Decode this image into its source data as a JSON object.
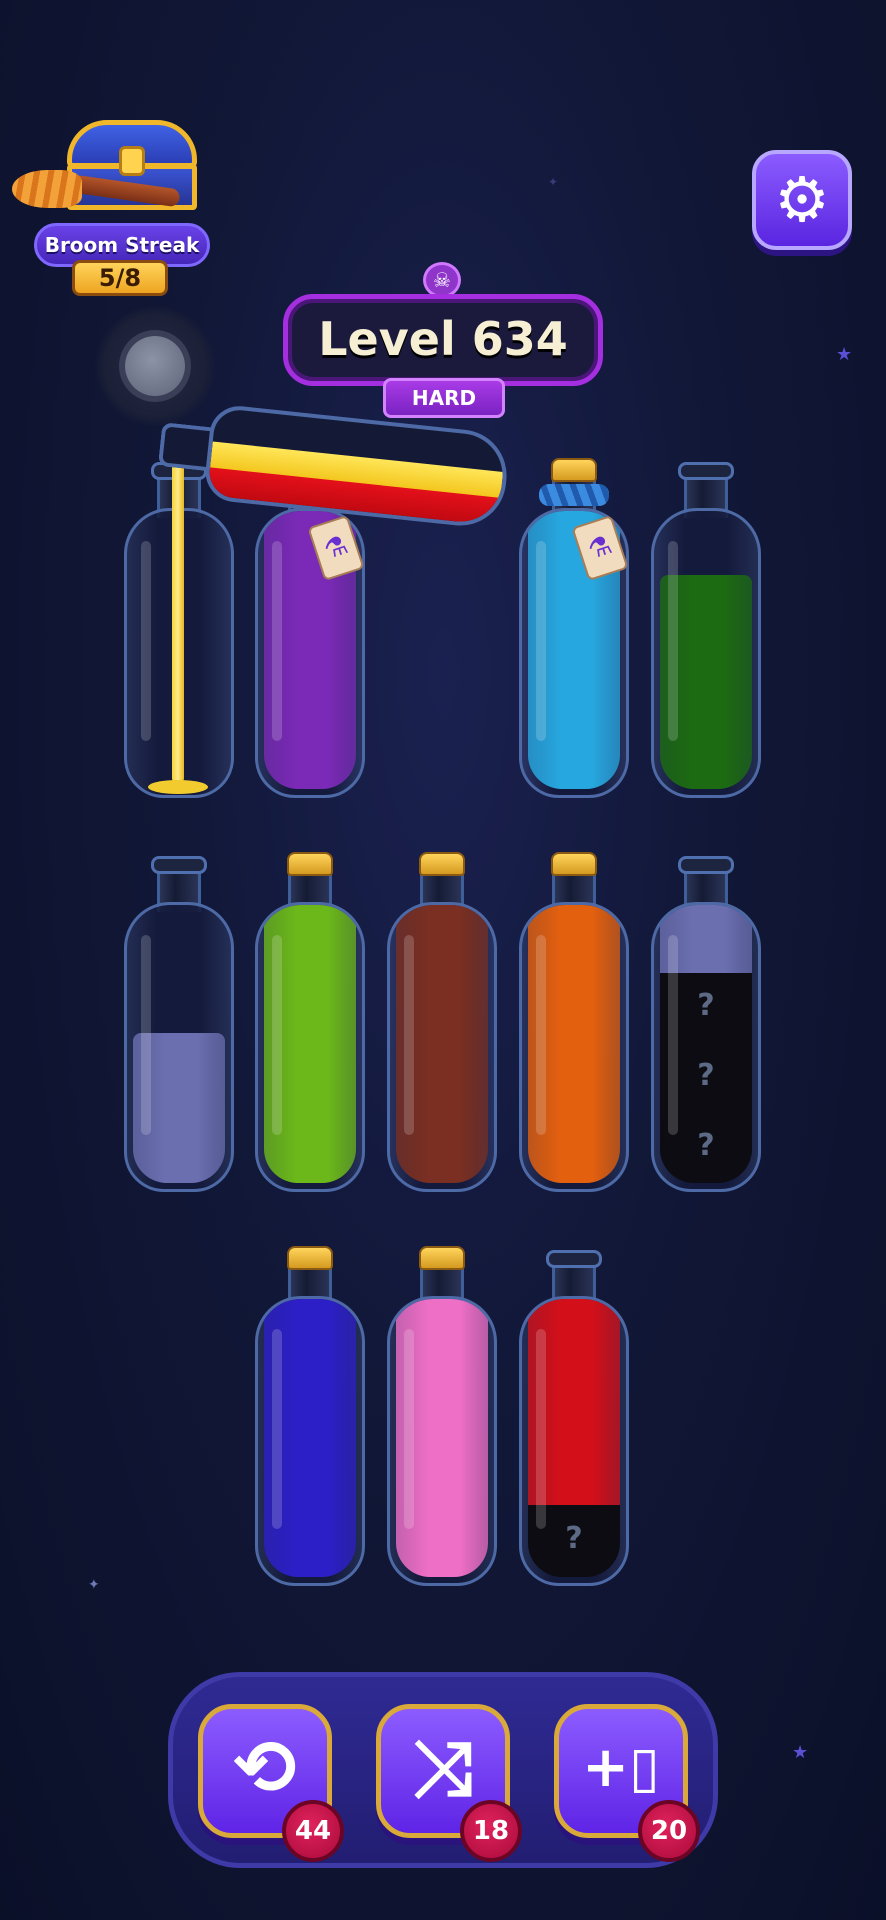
{
  "streak": {
    "label": "Broom Streak",
    "count": "5/8"
  },
  "level": {
    "title": "Level 634",
    "difficulty": "HARD"
  },
  "icons": {
    "settings": "gear-icon",
    "skull": "skull-icon",
    "undo": "undo-icon",
    "shuffle": "shuffle-icon",
    "add_bottle": "add-bottle-icon"
  },
  "bottles": [
    {
      "id": 1,
      "row": 1,
      "col": 1,
      "cork": false,
      "pouring_target": true,
      "layers": []
    },
    {
      "id": 2,
      "row": 1,
      "col": 2,
      "cork": false,
      "tag": true,
      "layers": [
        {
          "color": "#7a2ab6",
          "hidden": false
        }
      ]
    },
    {
      "id": 3,
      "row": 1,
      "col": 4,
      "cork": true,
      "rope": true,
      "tag": true,
      "layers": [
        {
          "color": "#27a7df",
          "hidden": false
        }
      ]
    },
    {
      "id": 4,
      "row": 1,
      "col": 5,
      "cork": false,
      "layers": [
        {
          "color": "#1c6b12",
          "hidden": false
        }
      ]
    },
    {
      "id": 5,
      "row": 2,
      "col": 1,
      "cork": false,
      "layers": [
        {
          "color": "#6b6fb0",
          "hidden": false
        }
      ]
    },
    {
      "id": 6,
      "row": 2,
      "col": 2,
      "cork": true,
      "layers": [
        {
          "color": "#6cb81a",
          "hidden": false
        }
      ]
    },
    {
      "id": 7,
      "row": 2,
      "col": 3,
      "cork": true,
      "layers": [
        {
          "color": "#7a2f22",
          "hidden": false
        }
      ]
    },
    {
      "id": 8,
      "row": 2,
      "col": 4,
      "cork": true,
      "layers": [
        {
          "color": "#e3600f",
          "hidden": false
        }
      ]
    },
    {
      "id": 9,
      "row": 2,
      "col": 5,
      "cork": false,
      "layers": [
        {
          "color": "#6b6fb0",
          "hidden": false
        },
        {
          "color": "#0c0c12",
          "hidden": true
        },
        {
          "color": "#0c0c12",
          "hidden": true
        },
        {
          "color": "#0c0c12",
          "hidden": true
        }
      ]
    },
    {
      "id": 10,
      "row": 3,
      "col": 2,
      "cork": true,
      "layers": [
        {
          "color": "#2d1fc7",
          "hidden": false
        }
      ]
    },
    {
      "id": 11,
      "row": 3,
      "col": 3,
      "cork": true,
      "layers": [
        {
          "color": "#ee6fc6",
          "hidden": false
        }
      ]
    },
    {
      "id": 12,
      "row": 3,
      "col": 4,
      "cork": false,
      "layers": [
        {
          "color": "#d3101a",
          "hidden": false
        },
        {
          "color": "#0c0c12",
          "hidden": true
        }
      ]
    }
  ],
  "pouring_bottle": {
    "layers": [
      "#f7d42a",
      "#d0101a"
    ],
    "stream_color": "#f4cf2c"
  },
  "boosters": [
    {
      "name": "undo",
      "symbol": "⟲",
      "count": "44"
    },
    {
      "name": "shuffle",
      "symbol": "⤨",
      "count": "18"
    },
    {
      "name": "add-bottle",
      "symbol": "+▯",
      "count": "20"
    }
  ],
  "hidden_marker": "?",
  "settings_symbol": "⚙",
  "skull_symbol": "☠"
}
